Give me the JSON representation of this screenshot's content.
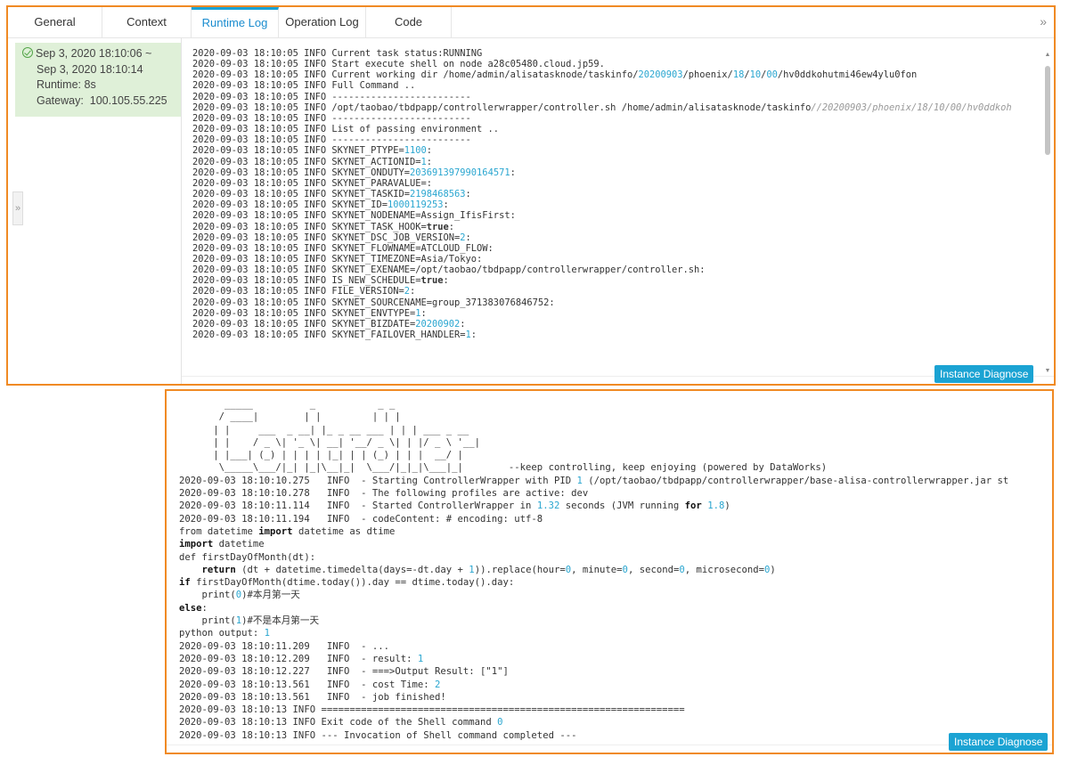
{
  "tabs": [
    {
      "label": "General",
      "active": false
    },
    {
      "label": "Context",
      "active": false
    },
    {
      "label": "Runtime Log",
      "active": true
    },
    {
      "label": "Operation Log",
      "active": false
    },
    {
      "label": "Code",
      "active": false
    }
  ],
  "sidebar": {
    "time_line1": "Sep 3, 2020 18:10:06 ~",
    "time_line2": "Sep 3, 2020 18:10:14",
    "runtime": "Runtime: 8s",
    "gateway": "Gateway:  100.105.55.225"
  },
  "instance_diagnose_label": "Instance Diagnose",
  "runtime_log": [
    "2020-09-03 18:10:05 INFO Current task status:RUNNING",
    "2020-09-03 18:10:05 INFO Start execute shell on node a28c05480.cloud.jp59.",
    "2020-09-03 18:10:05 INFO Current working dir /home/admin/alisatasknode/taskinfo/20200903/phoenix/18/10/00/hv0ddkohutmi46ew4ylu0fon",
    "2020-09-03 18:10:05 INFO Full Command ..",
    "2020-09-03 18:10:05 INFO -------------------------",
    "2020-09-03 18:10:05 INFO /opt/taobao/tbdpapp/controllerwrapper/controller.sh /home/admin/alisatasknode/taskinfo//20200903/phoenix/18/10/00/hv0ddkoh",
    "2020-09-03 18:10:05 INFO -------------------------",
    "2020-09-03 18:10:05 INFO List of passing environment ..",
    "2020-09-03 18:10:05 INFO -------------------------",
    "2020-09-03 18:10:05 INFO SKYNET_PTYPE=1100:",
    "2020-09-03 18:10:05 INFO SKYNET_ACTIONID=1:",
    "2020-09-03 18:10:05 INFO SKYNET_ONDUTY=203691397990164571:",
    "2020-09-03 18:10:05 INFO SKYNET_PARAVALUE=:",
    "2020-09-03 18:10:05 INFO SKYNET_TASKID=2198468563:",
    "2020-09-03 18:10:05 INFO SKYNET_ID=1000119253:",
    "2020-09-03 18:10:05 INFO SKYNET_NODENAME=Assign_IfisFirst:",
    "2020-09-03 18:10:05 INFO SKYNET_TASK_HOOK=true:",
    "2020-09-03 18:10:05 INFO SKYNET_DSC_JOB_VERSION=2:",
    "2020-09-03 18:10:05 INFO SKYNET_FLOWNAME=ATCLOUD_FLOW:",
    "2020-09-03 18:10:05 INFO SKYNET_TIMEZONE=Asia/Tokyo:",
    "2020-09-03 18:10:05 INFO SKYNET_EXENAME=/opt/taobao/tbdpapp/controllerwrapper/controller.sh:",
    "2020-09-03 18:10:05 INFO IS_NEW_SCHEDULE=true:",
    "2020-09-03 18:10:05 INFO FILE_VERSION=2:",
    "2020-09-03 18:10:05 INFO SKYNET_SOURCENAME=group_371383076846752:",
    "2020-09-03 18:10:05 INFO SKYNET_ENVTYPE=1:",
    "2020-09-03 18:10:05 INFO SKYNET_BIZDATE=20200902:",
    "2020-09-03 18:10:05 INFO SKYNET_FAILOVER_HANDLER=1:"
  ],
  "output_log": [
    "        _____          _           _ _",
    "       / ____|        | |         | | |",
    "      | |     ___  _ __| |_ _ __ ___ | | | ___ _ __",
    "      | |    / _ \\| '_ \\| __| '__/ _ \\| | |/ _ \\ '__|",
    "      | |___| (_) | | | | |_| | | (_) | | |  __/ |",
    "       \\_____\\___/|_| |_|\\__|_|  \\___/|_|_|\\___|_|        --keep controlling, keep enjoying (powered by DataWorks)",
    "2020-09-03 18:10:10.275   INFO  - Starting ControllerWrapper with PID 1 (/opt/taobao/tbdpapp/controllerwrapper/base-alisa-controllerwrapper.jar st",
    "2020-09-03 18:10:10.278   INFO  - The following profiles are active: dev",
    "2020-09-03 18:10:11.114   INFO  - Started ControllerWrapper in 1.32 seconds (JVM running for 1.8)",
    "2020-09-03 18:10:11.194   INFO  - codeContent: # encoding: utf-8",
    "from datetime import datetime as dtime",
    "import datetime",
    "def firstDayOfMonth(dt):",
    "    return (dt + datetime.timedelta(days=-dt.day + 1)).replace(hour=0, minute=0, second=0, microsecond=0)",
    "if firstDayOfMonth(dtime.today()).day == dtime.today().day:",
    "    print(0)#本月第一天",
    "else:",
    "    print(1)#不是本月第一天",
    "python output: 1",
    "2020-09-03 18:10:11.209   INFO  - ...",
    "2020-09-03 18:10:12.209   INFO  - result: 1",
    "2020-09-03 18:10:12.227   INFO  - ===>Output Result: [\"1\"]",
    "2020-09-03 18:10:13.561   INFO  - cost Time: 2",
    "2020-09-03 18:10:13.561   INFO  - job finished!",
    "2020-09-03 18:10:13 INFO ================================================================",
    "2020-09-03 18:10:13 INFO Exit code of the Shell command 0",
    "2020-09-03 18:10:13 INFO --- Invocation of Shell command completed ---"
  ],
  "colors": {
    "accent": "#1ba3d3",
    "highlight_border": "#f08a24",
    "sidebar_bg": "#dff0d8",
    "number": "#2aa6d0"
  }
}
